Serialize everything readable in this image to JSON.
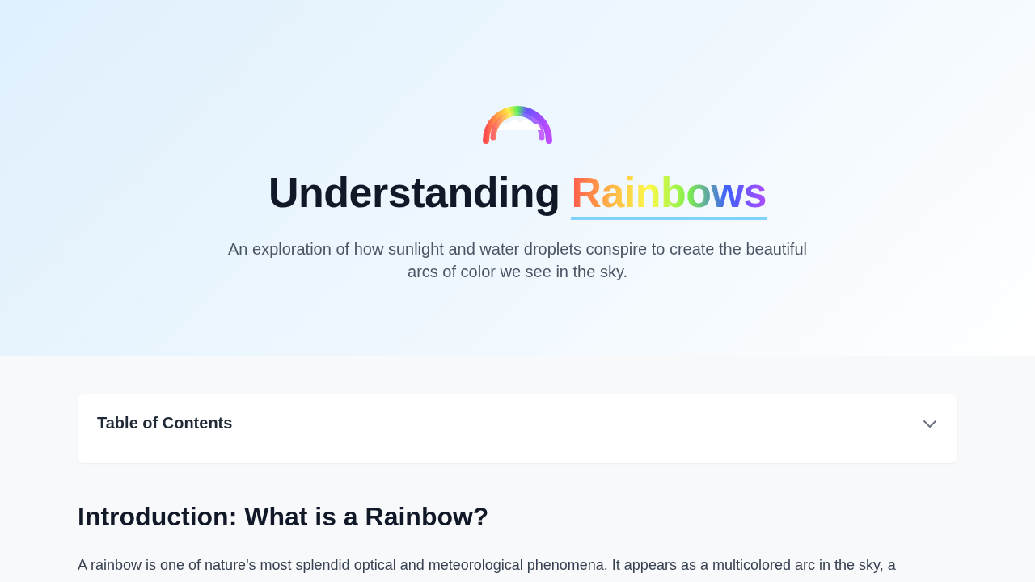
{
  "hero": {
    "title_start": "Understanding",
    "title_highlight": "Rainbows",
    "subtitle": "An exploration of how sunlight and water droplets conspire to create the beautiful arcs of color we see in the sky."
  },
  "toc": {
    "title": "Table of Contents",
    "expanded": false
  },
  "section": {
    "heading": "Introduction: What is a Rainbow?",
    "paragraph": "A rainbow is one of nature's most splendid optical and meteorological phenomena. It appears as a multicolored arc in the sky, a"
  }
}
